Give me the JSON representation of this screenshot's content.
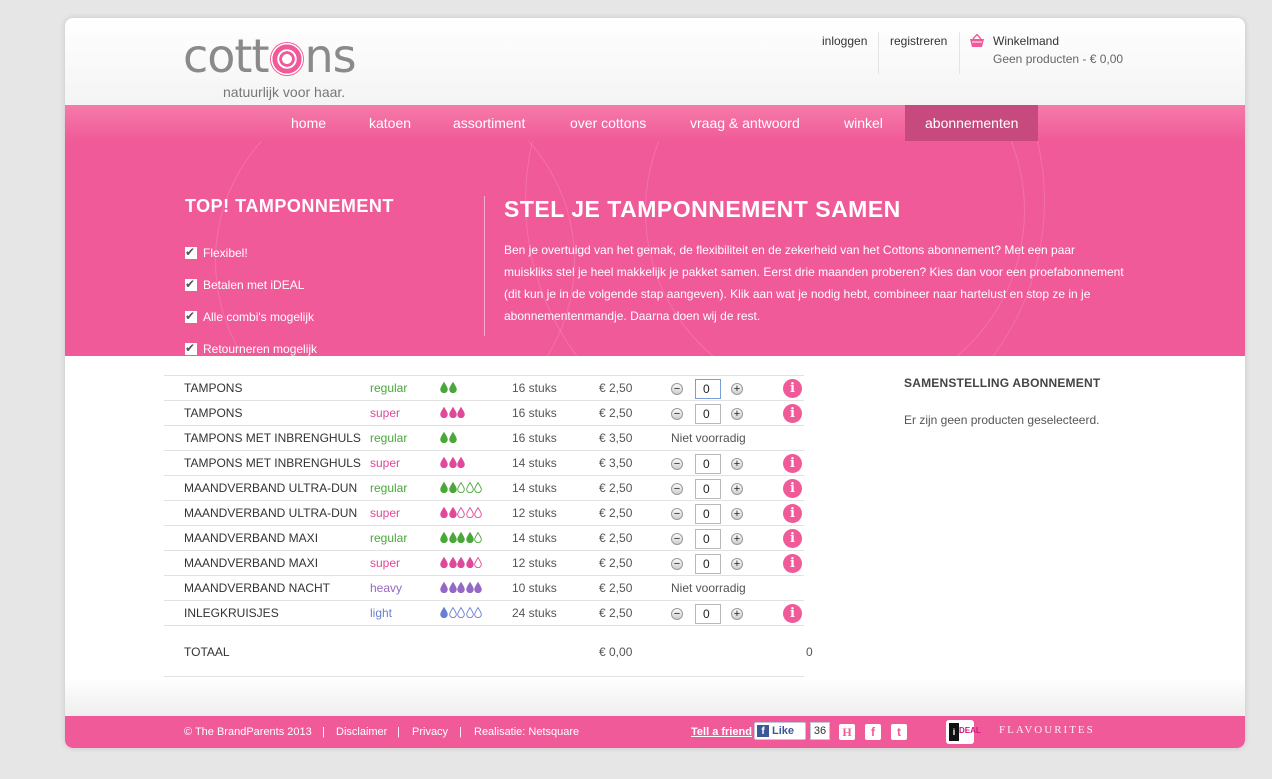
{
  "brand": {
    "name_pre": "cott",
    "name_post": "ns",
    "tagline": "natuurlijk voor haar.",
    "accent": "#f15a99"
  },
  "topnav": {
    "login": "inloggen",
    "register": "registreren",
    "cart_title": "Winkelmand",
    "cart_status": "Geen producten - € 0,00"
  },
  "nav": {
    "items": [
      "home",
      "katoen",
      "assortiment",
      "over cottons",
      "vraag & antwoord",
      "winkel",
      "abonnementen"
    ],
    "active": "abonnementen"
  },
  "hero": {
    "left_title": "TOP! TAMPONNEMENT",
    "checks": [
      "Flexibel!",
      "Betalen met iDEAL",
      "Alle combi's mogelijk",
      "Retourneren mogelijk"
    ],
    "title": "STEL JE TAMPONNEMENT SAMEN",
    "text": "Ben je overtuigd van het gemak, de flexibiliteit en de zekerheid van het Cottons abonnement? Met een paar muiskliks stel je heel makkelijk je pakket samen. Eerst drie maanden proberen? Kies dan voor een proefabonnement (dit kun je in de volgende stap aangeven). Klik aan wat je nodig hebt, combineer naar hartelust en stop ze in je abonnementenmandje. Daarna doen wij de rest."
  },
  "products": [
    {
      "name": "TAMPONS",
      "type": "regular",
      "color": "green",
      "filled": 2,
      "total": 2,
      "pack": "16 stuks",
      "price": "€ 2,50",
      "available": true,
      "qty": "0"
    },
    {
      "name": "TAMPONS",
      "type": "super",
      "color": "pink",
      "filled": 3,
      "total": 3,
      "pack": "16 stuks",
      "price": "€ 2,50",
      "available": true,
      "qty": "0"
    },
    {
      "name": "TAMPONS MET INBRENGHULS",
      "type": "regular",
      "color": "green",
      "filled": 2,
      "total": 2,
      "pack": "16 stuks",
      "price": "€ 3,50",
      "available": false,
      "status": "Niet voorradig"
    },
    {
      "name": "TAMPONS MET INBRENGHULS",
      "type": "super",
      "color": "pink",
      "filled": 3,
      "total": 3,
      "pack": "14 stuks",
      "price": "€ 3,50",
      "available": true,
      "qty": "0"
    },
    {
      "name": "MAANDVERBAND ULTRA-DUN",
      "type": "regular",
      "color": "green",
      "filled": 2,
      "total": 5,
      "pack": "14 stuks",
      "price": "€ 2,50",
      "available": true,
      "qty": "0"
    },
    {
      "name": "MAANDVERBAND ULTRA-DUN",
      "type": "super",
      "color": "pink",
      "filled": 2,
      "total": 5,
      "pack": "12 stuks",
      "price": "€ 2,50",
      "available": true,
      "qty": "0"
    },
    {
      "name": "MAANDVERBAND MAXI",
      "type": "regular",
      "color": "green",
      "filled": 4,
      "total": 5,
      "pack": "14 stuks",
      "price": "€ 2,50",
      "available": true,
      "qty": "0"
    },
    {
      "name": "MAANDVERBAND MAXI",
      "type": "super",
      "color": "pink",
      "filled": 4,
      "total": 5,
      "pack": "12 stuks",
      "price": "€ 2,50",
      "available": true,
      "qty": "0"
    },
    {
      "name": "MAANDVERBAND NACHT",
      "type": "heavy",
      "color": "purple",
      "filled": 5,
      "total": 5,
      "pack": "10 stuks",
      "price": "€ 2,50",
      "available": false,
      "status": "Niet voorradig"
    },
    {
      "name": "INLEGKRUISJES",
      "type": "light",
      "color": "blue",
      "filled": 1,
      "total": 5,
      "pack": "24 stuks",
      "price": "€ 2,50",
      "available": true,
      "qty": "0"
    }
  ],
  "colors": {
    "green": "#4aa83a",
    "pink": "#e0489a",
    "purple": "#9568c5",
    "blue": "#6b7fd0"
  },
  "total": {
    "label": "TOTAAL",
    "amount": "€ 0,00",
    "count": "0"
  },
  "sidebar": {
    "title": "SAMENSTELLING ABONNEMENT",
    "empty": "Er zijn geen producten geselecteerd."
  },
  "footer": {
    "copyright": "© The BrandParents 2013",
    "disclaimer": "Disclaimer",
    "privacy": "Privacy",
    "credit": "Realisatie: Netsquare",
    "tell": "Tell a friend",
    "like": "Like",
    "like_count": "36",
    "partner": "FLAVOURITES",
    "icons": [
      "hyves-icon",
      "facebook-icon",
      "twitter-icon",
      "ideal-logo"
    ]
  }
}
